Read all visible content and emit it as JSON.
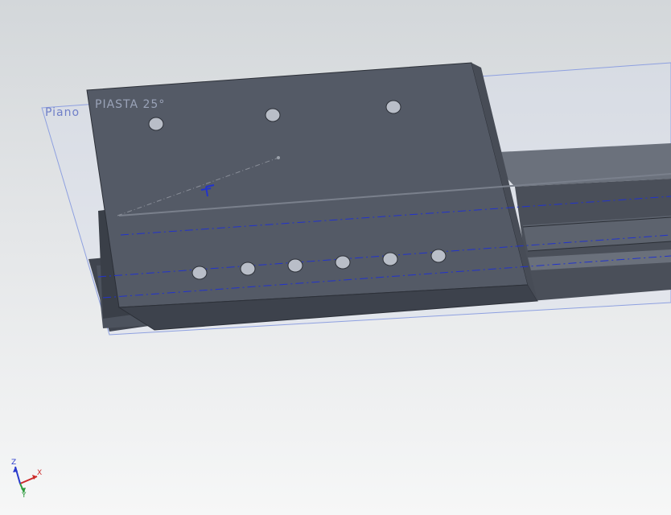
{
  "viewport": {
    "plane_label": "Piano",
    "feature_label": "PIASTA 25°"
  },
  "triad": {
    "x_label": "X",
    "y_label": "Y",
    "z_label": "Z",
    "x_color": "#cc2a2a",
    "y_color": "#2a9a3a",
    "z_color": "#2a3acc"
  },
  "colors": {
    "plate_top": "#545a66",
    "plate_side": "#3d424c",
    "rail": "#5f6570",
    "plane_border": "#8ea0e0",
    "centerline": "#2233cc"
  }
}
